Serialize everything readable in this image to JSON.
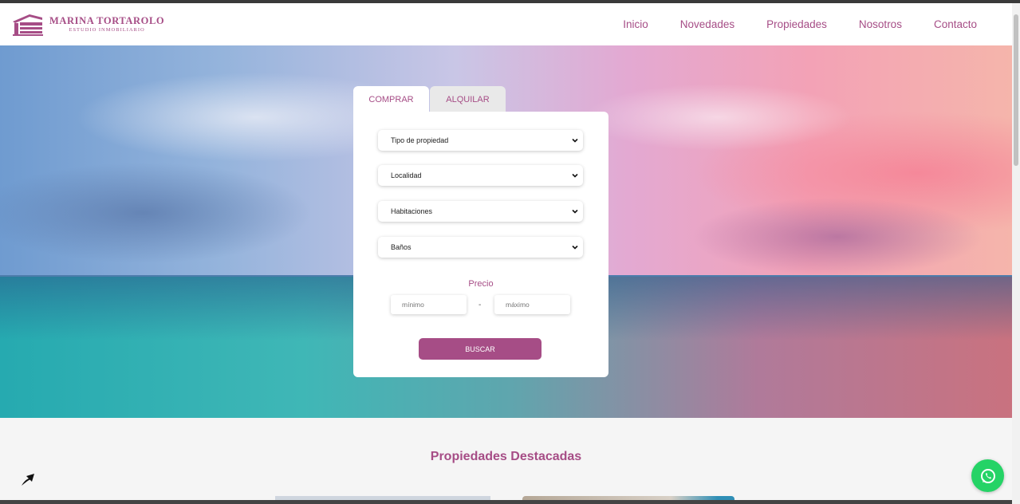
{
  "brand": {
    "name": "MARINA TORTAROLO",
    "tagline": "ESTUDIO INMOBILIARIO",
    "logo_icon": "house-logo-icon",
    "accent_color": "#a64d86"
  },
  "nav": {
    "items": [
      {
        "label": "Inicio"
      },
      {
        "label": "Novedades"
      },
      {
        "label": "Propiedades"
      },
      {
        "label": "Nosotros"
      },
      {
        "label": "Contacto"
      }
    ]
  },
  "search": {
    "tabs": [
      {
        "label": "COMPRAR",
        "active": true
      },
      {
        "label": "ALQUILAR",
        "active": false
      }
    ],
    "selects": [
      {
        "value": "Tipo de propiedad"
      },
      {
        "value": "Localidad"
      },
      {
        "value": "Habitaciones"
      },
      {
        "value": "Baños"
      }
    ],
    "price_label": "Precio",
    "min_placeholder": "mínimo",
    "max_placeholder": "máximo",
    "separator": "-",
    "submit_label": "BUSCAR"
  },
  "featured": {
    "title": "Propiedades Destacadas"
  },
  "floating": {
    "back_to_top_icon": "arrow-up-icon",
    "whatsapp_icon": "whatsapp-icon",
    "whatsapp_color": "#25d366"
  }
}
